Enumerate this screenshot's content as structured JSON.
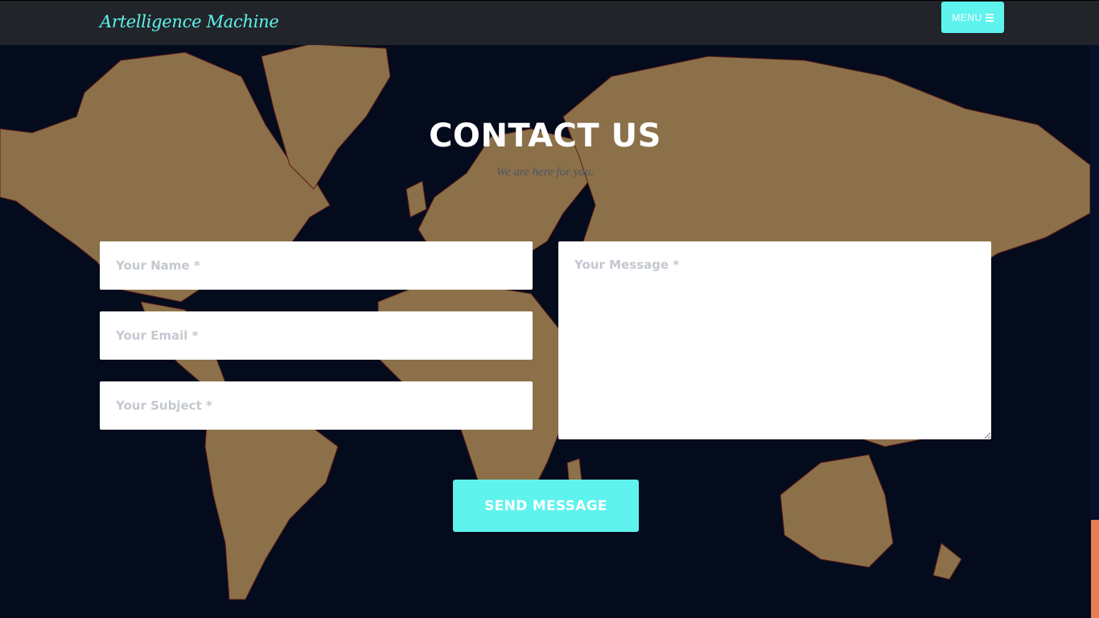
{
  "navbar": {
    "brand": "Artelligence Machine",
    "menu_label": "MENU",
    "menu_icon": "bars-icon"
  },
  "contact": {
    "heading": "CONTACT US",
    "subheading": "We are here for you.",
    "name_placeholder": "Your Name *",
    "email_placeholder": "Your Email *",
    "subject_placeholder": "Your Subject *",
    "message_placeholder": "Your Message *",
    "send_label": "SEND MESSAGE"
  },
  "colors": {
    "accent": "#5ff3ee",
    "background": "#040b1c",
    "navbar": "#212529",
    "land": "#8b7049",
    "scroll_thumb": "#ea7c53"
  }
}
